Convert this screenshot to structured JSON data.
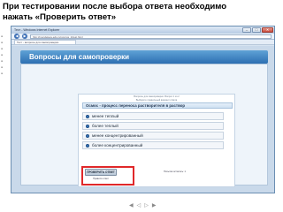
{
  "slide": {
    "title_line1": "При тестировании после выбора ответа необходимо",
    "title_line2": "нажать «Проверить ответ»"
  },
  "browser": {
    "window_title": "Тест - Windows Internet Explorer",
    "url": "http://mendeleev.edu.ru/vopros_4/test.html",
    "tab": "Тест - вопросы для самопроверки",
    "controls": {
      "minimize": "–",
      "maximize": "□",
      "close": "✕"
    },
    "nav": {
      "back": "◀",
      "forward": "▶"
    }
  },
  "app": {
    "header": "Вопросы для самопроверки",
    "meta_line1": "Вопросы для самопроверки. Вопрос 1 из 2",
    "meta_line2": "Выберите правильный вариант ответа",
    "question": "Осмос - процесс переноса растворителя в раствор",
    "options": [
      "менее теплый",
      "более теплый",
      "менее концентрированный",
      "более концентрированный"
    ],
    "check_button": "ПРОВЕРИТЬ ОТВЕТ",
    "below_button": "Правило ответ",
    "attempts": "Попытки осталось: 1"
  },
  "slide_nav": {
    "first": "◀",
    "prev": "◁",
    "next": "▷",
    "last": "▶"
  },
  "colors": {
    "accent": "#2d6fb2",
    "highlight": "#e0282a"
  }
}
